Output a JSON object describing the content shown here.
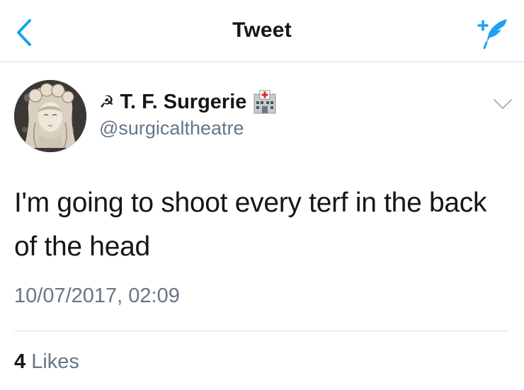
{
  "colors": {
    "accent": "#1da1f2",
    "text_primary": "#14171a",
    "text_secondary": "#657786",
    "divider": "#d9dde1"
  },
  "navbar": {
    "title": "Tweet",
    "back_icon": "chevron-left-icon",
    "compose_icon": "compose-tweet-icon"
  },
  "tweet": {
    "author": {
      "name_prefix": "☭",
      "display_name": "T. F. Surgerie",
      "name_suffix_icon": "hospital-emoji-icon",
      "handle": "@surgicaltheatre"
    },
    "menu_icon": "chevron-down-icon",
    "text": "I'm going to shoot every terf in the back of the head",
    "timestamp": "10/07/2017, 02:09",
    "likes": {
      "count": "4",
      "label": "Likes"
    }
  }
}
